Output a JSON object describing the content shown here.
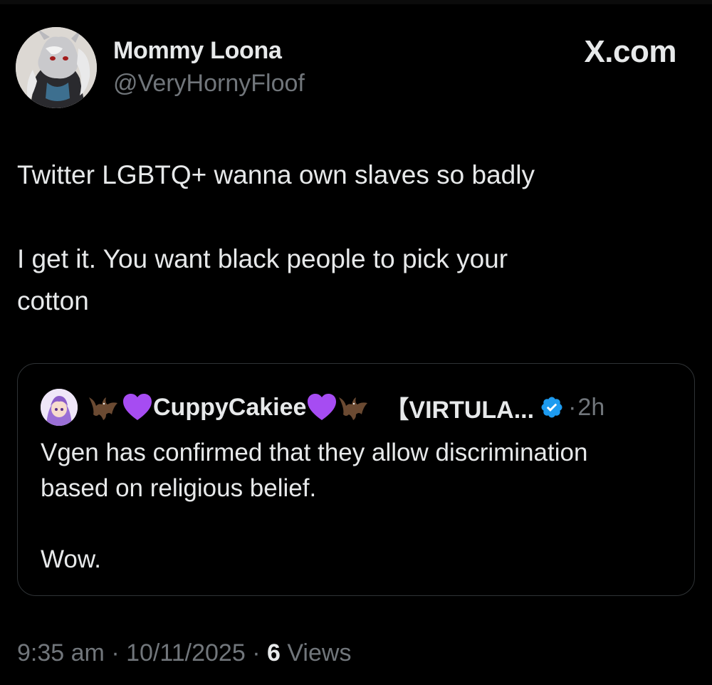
{
  "tweet": {
    "author": {
      "display_name": "Mommy Loona",
      "handle": "@VeryHornyFloof"
    },
    "brand": "X.com",
    "text_lines": [
      "Twitter LGBTQ+ wanna own slaves so badly",
      "I get it. You want black people to pick your",
      "cotton"
    ],
    "quote": {
      "author_name": "CuppyCakiee",
      "author_tag": "【VIRTULA...",
      "verified": true,
      "time_separator": "·",
      "time": "2h",
      "text_lines": [
        "Vgen has confirmed that they allow discrimination",
        "based on religious belief.",
        "Wow."
      ]
    },
    "meta": {
      "time": "9:35 am",
      "separator": "·",
      "date": "10/11/2025",
      "views_count": "6",
      "views_label": "Views"
    }
  },
  "icons": {
    "bat": "bat-emoji",
    "heart": "purple-heart-emoji",
    "verified": "verified-badge-icon"
  },
  "colors": {
    "background": "#000000",
    "text": "#e7e9ea",
    "secondary_text": "#71767b",
    "border": "#2f3336",
    "verified": "#1d9bf0",
    "heart": "#a64cf2"
  }
}
